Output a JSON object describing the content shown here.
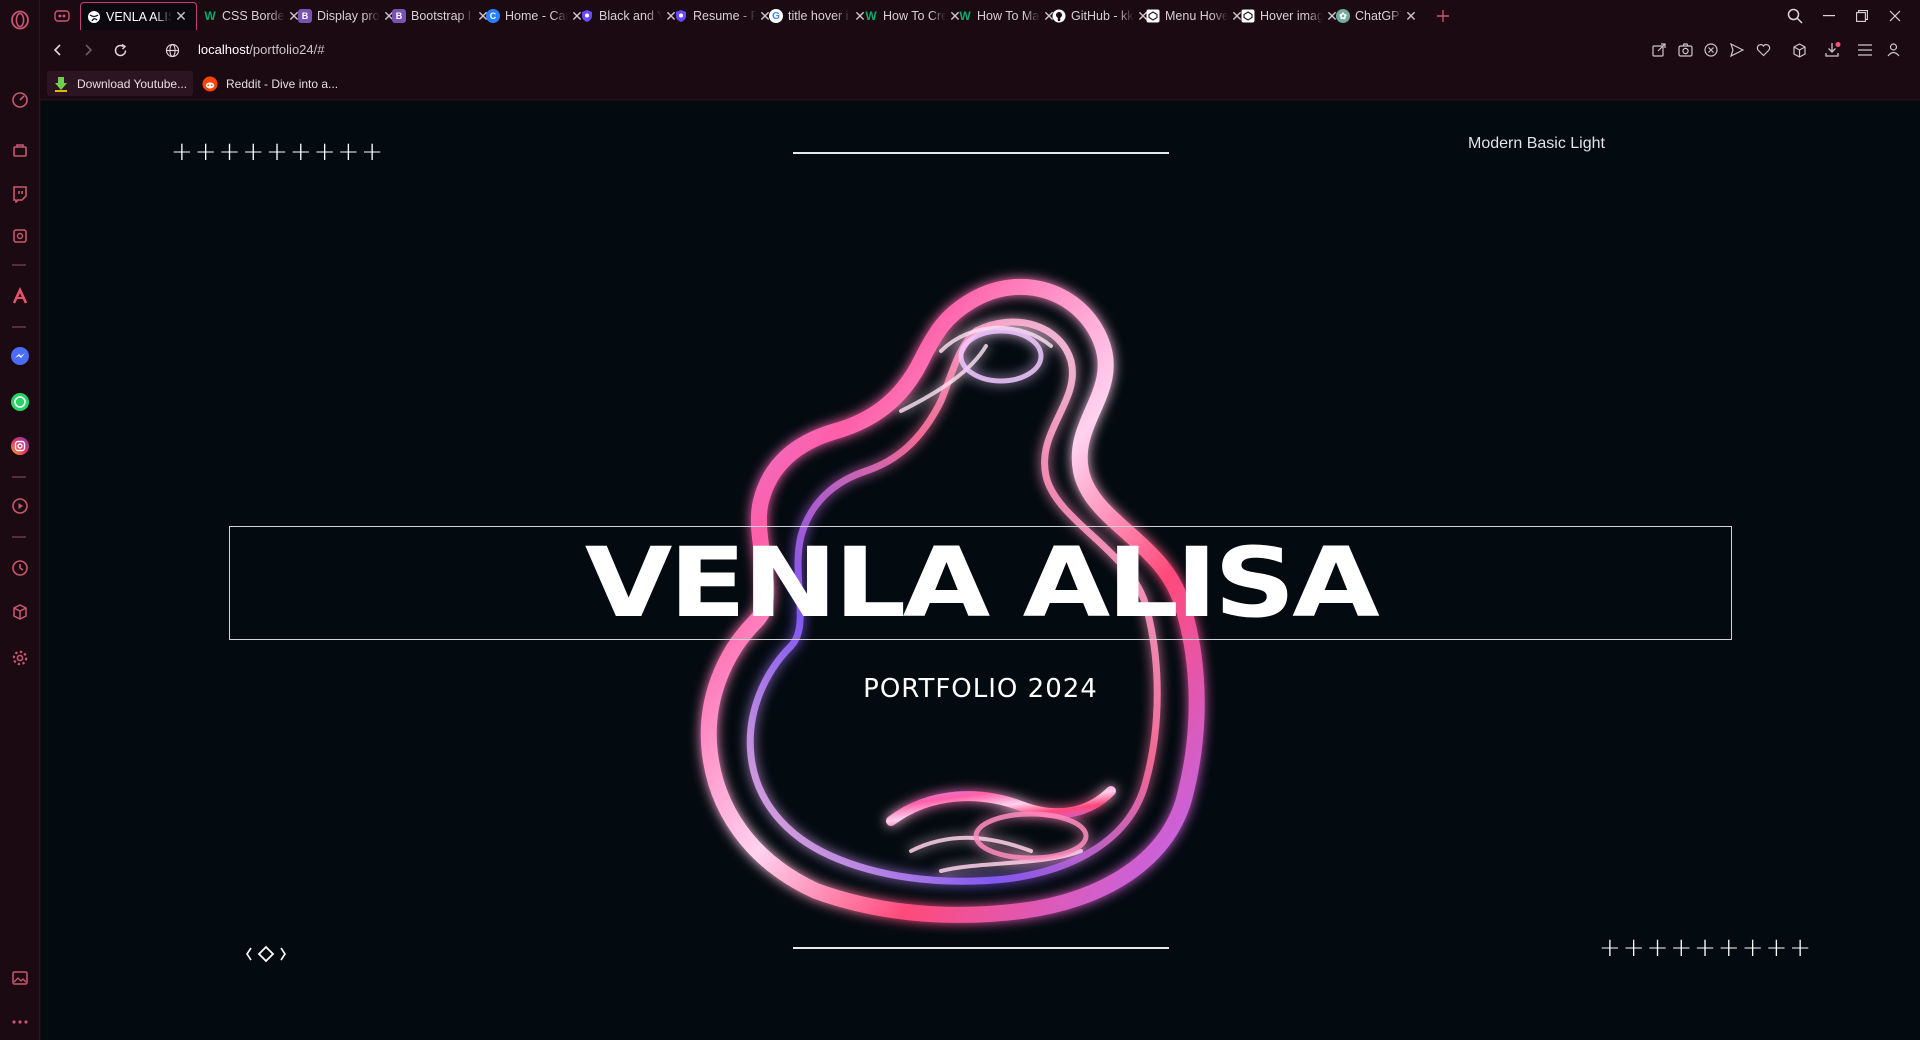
{
  "browser": {
    "tabs": [
      {
        "label": "VENLA ALISA",
        "favicon": "globe-icon",
        "color": "#ffffff",
        "active": true
      },
      {
        "label": "CSS Border",
        "favicon": "w3schools-icon",
        "color": "#04aa6d"
      },
      {
        "label": "Display pro",
        "favicon": "bootstrap-icon",
        "color": "#7952b3"
      },
      {
        "label": "Bootstrap l",
        "favicon": "bootstrap-icon",
        "color": "#7952b3"
      },
      {
        "label": "Home - Car",
        "favicon": "c-icon",
        "color": "#2a7fff"
      },
      {
        "label": "Black and Y",
        "favicon": "shield-icon",
        "color": "#6a4bff"
      },
      {
        "label": "Resume - P",
        "favicon": "shield-icon",
        "color": "#6a4bff"
      },
      {
        "label": "title hover i",
        "favicon": "google-icon",
        "color": "#ffffff"
      },
      {
        "label": "How To Cre",
        "favicon": "w3schools-icon",
        "color": "#04aa6d"
      },
      {
        "label": "How To Ma",
        "favicon": "w3schools-icon",
        "color": "#04aa6d"
      },
      {
        "label": "GitHub - kk",
        "favicon": "github-icon",
        "color": "#ffffff"
      },
      {
        "label": "Menu Hove",
        "favicon": "codepen-icon",
        "color": "#ffffff"
      },
      {
        "label": "Hover imag",
        "favicon": "codepen-icon",
        "color": "#ffffff"
      },
      {
        "label": "ChatGPT",
        "favicon": "chatgpt-icon",
        "color": "#74aa9c"
      }
    ],
    "url_host": "localhost",
    "url_path": "/portfolio24/#",
    "bookmarks": [
      {
        "label": "Download Youtube...",
        "icon": "download-arrow-icon"
      },
      {
        "label": "Reddit - Dive into a...",
        "icon": "reddit-icon"
      }
    ],
    "accent_color": "#c73d6d"
  },
  "page": {
    "decor_plus": "+++++++++",
    "style_label": "Modern Basic Light",
    "title": "VENLA ALISA",
    "subtitle": "PORTFOLIO 2024",
    "background_color": "#030a10"
  }
}
